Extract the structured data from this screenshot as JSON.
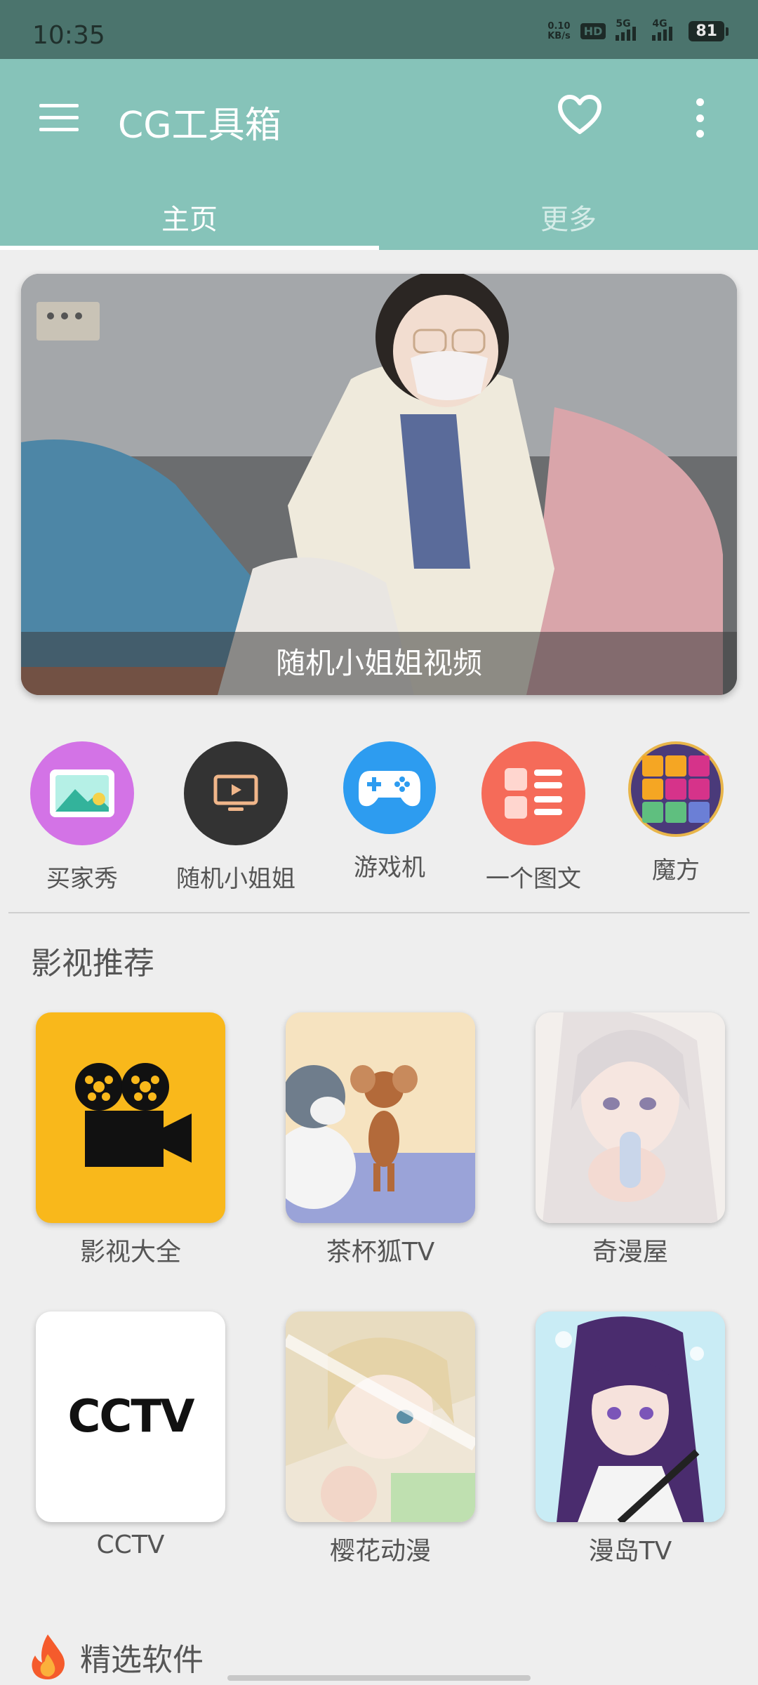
{
  "status_bar": {
    "time": "10:35",
    "net_speed_value": "0.10",
    "net_speed_unit": "KB/s",
    "hd_badge": "HD",
    "signal_1": "5G",
    "signal_2": "4G",
    "battery": "81"
  },
  "app_bar": {
    "title": "CG工具箱",
    "tabs": [
      {
        "label": "主页",
        "active": true
      },
      {
        "label": "更多",
        "active": false
      }
    ],
    "colors": {
      "primary": "#86c3b9",
      "status": "#4b746d"
    }
  },
  "banner": {
    "caption": "随机小姐姐视频"
  },
  "quick_actions": [
    {
      "label": "买家秀",
      "icon": "picture-icon",
      "color": "#d373e6"
    },
    {
      "label": "随机小姐姐",
      "icon": "tv-icon",
      "color": "#333333"
    },
    {
      "label": "游戏机",
      "icon": "gamepad-icon",
      "color": "#2d9cf0"
    },
    {
      "label": "一个图文",
      "icon": "article-list-icon",
      "color": "#f56b59"
    },
    {
      "label": "魔方",
      "icon": "cube-icon",
      "color": "#4a3a7a"
    }
  ],
  "video_section": {
    "title": "影视推荐",
    "items": [
      {
        "label": "影视大全"
      },
      {
        "label": "茶杯狐TV"
      },
      {
        "label": "奇漫屋"
      },
      {
        "label": "CCTV",
        "logo_text": "CCTV"
      },
      {
        "label": "樱花动漫"
      },
      {
        "label": "漫岛TV"
      }
    ]
  },
  "featured_section": {
    "title": "精选软件"
  }
}
